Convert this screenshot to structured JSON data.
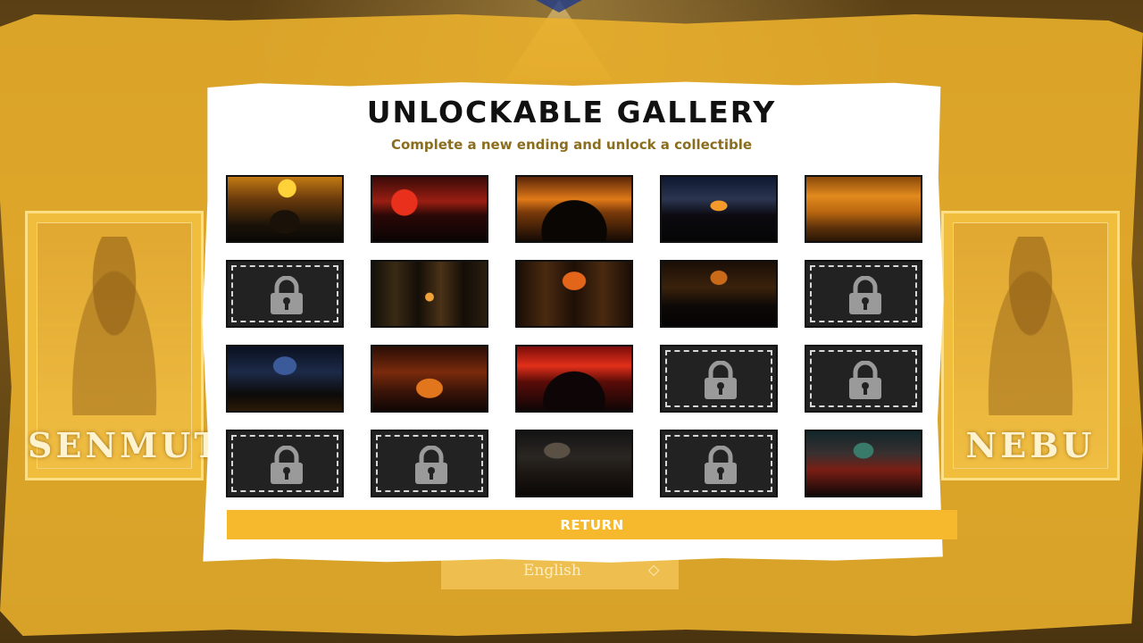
{
  "header": {
    "title": "UNLOCKABLE GALLERY",
    "subtitle": "Complete a new ending and unlock a collectible"
  },
  "characters": {
    "left": "SENMUT",
    "right": "NEBU"
  },
  "language": {
    "selected": "English",
    "icon": "chevron-down-icon"
  },
  "gallery": {
    "tiles": [
      {
        "state": "unlocked",
        "scene": "sunset-warrior"
      },
      {
        "state": "unlocked",
        "scene": "red-sun-pyramids"
      },
      {
        "state": "unlocked",
        "scene": "fire-pyramid-crowd"
      },
      {
        "state": "unlocked",
        "scene": "night-pyramid-city"
      },
      {
        "state": "unlocked",
        "scene": "desert-wanderer"
      },
      {
        "state": "locked",
        "icon": "lock-icon"
      },
      {
        "state": "unlocked",
        "scene": "temple-throne"
      },
      {
        "state": "unlocked",
        "scene": "columned-hall"
      },
      {
        "state": "unlocked",
        "scene": "dark-pyramid"
      },
      {
        "state": "locked",
        "icon": "lock-icon"
      },
      {
        "state": "unlocked",
        "scene": "blue-temple"
      },
      {
        "state": "unlocked",
        "scene": "fiery-gate"
      },
      {
        "state": "unlocked",
        "scene": "red-sky-pyramid"
      },
      {
        "state": "locked",
        "icon": "lock-icon"
      },
      {
        "state": "locked",
        "icon": "lock-icon"
      },
      {
        "state": "locked",
        "icon": "lock-icon"
      },
      {
        "state": "locked",
        "icon": "lock-icon"
      },
      {
        "state": "unlocked",
        "scene": "pyramid-procession"
      },
      {
        "state": "locked",
        "icon": "lock-icon"
      },
      {
        "state": "unlocked",
        "scene": "teal-pyramid-army"
      }
    ]
  },
  "actions": {
    "return_label": "RETURN"
  },
  "colors": {
    "accent": "#f6b92d",
    "subtitle": "#8a6d1e",
    "locked_tile": "#222222",
    "background_band": "#ecb22c"
  }
}
